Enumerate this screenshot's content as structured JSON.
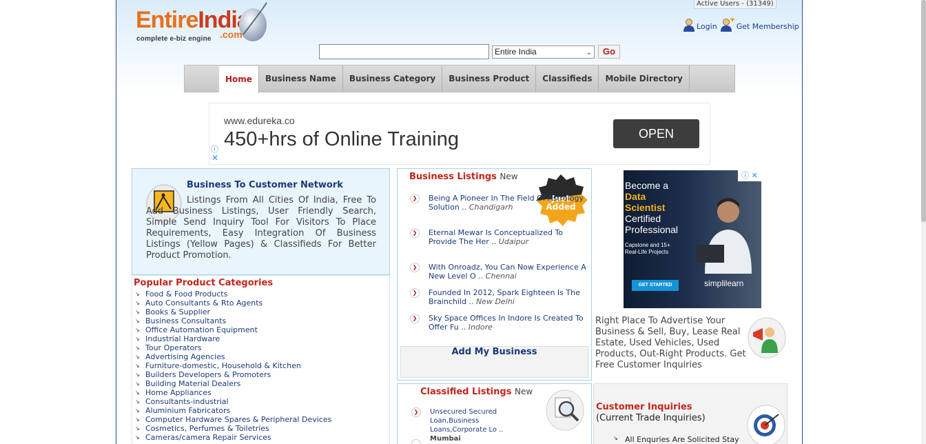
{
  "header": {
    "logo": {
      "part1": "Entire",
      "part2": "India",
      "com": ".com",
      "tagline": "complete e-biz engine"
    },
    "active_users": "Active Users - (31349)",
    "login_label": "Login",
    "membership_label": "Get Membership"
  },
  "search": {
    "value": "",
    "city_selected": "Entire India",
    "go_label": "Go"
  },
  "nav": {
    "tabs": [
      {
        "label": "Home",
        "active": true
      },
      {
        "label": "Business Name"
      },
      {
        "label": "Business Category"
      },
      {
        "label": "Business Product"
      },
      {
        "label": "Classifieds"
      },
      {
        "label": "Mobile Directory"
      }
    ]
  },
  "ad_top": {
    "url": "www.edureka.co",
    "headline": "450+hrs of Online Training",
    "button": "OPEN",
    "info_glyph": "ⓘ",
    "close_glyph": "✕"
  },
  "b2c": {
    "title": "Business To Customer Network",
    "description": "Listings From All Cities Of India, Free To Add Business Listings, User Friendly Search, Simple Send Inquiry Tool For Visitors To Place Requirements, Easy Integration Of Business Listings (Yellow Pages) & Classifieds For Better Product Promotion."
  },
  "popular": {
    "title": "Popular Product Categories",
    "items": [
      "Food & Food Products",
      "Auto Consultants & Rto Agents",
      "Books & Supplier",
      "Business Consultants",
      "Office Automation Equipment",
      "Industrial Hardware",
      "Tour Operators",
      "Advertising Agencies",
      "Furniture-domestic, Household & Kitchen",
      "Builders Developers & Promoters",
      "Building Material Dealers",
      "Home Appliances",
      "Consultants-industrial",
      "Aluminium Fabricators",
      "Computer Hardware Spares & Peripheral Devices",
      "Cosmetics, Perfumes & Toiletries",
      "Cameras/camera Repair Services"
    ]
  },
  "business_listings": {
    "title": "Business Listings",
    "new_label": "New",
    "badge_line1": "Just",
    "badge_line2": "Added",
    "items": [
      {
        "text": "Being A Pioneer In The Field Of Astrology Solution ..",
        "city": "Chandigarh"
      },
      {
        "text": "Eternal Mewar Is Conceptualized To Provide The Her ..",
        "city": "Udaipur"
      },
      {
        "text": "With Onroadz, You Can Now Experience A New Level O ..",
        "city": "Chennai"
      },
      {
        "text": "Founded In 2012, Spark Eighteen Is The Brainchild ..",
        "city": "New Delhi"
      },
      {
        "text": "Sky Space Offices In Indore Is Created To Offer Fu ..",
        "city": "Indore"
      }
    ],
    "add_label": "Add My Business"
  },
  "classified_listings": {
    "title": "Classified Listings",
    "new_label": "New",
    "items": [
      {
        "text": "Unsecured Secured Loan,Business Loans,Corporate Lo ..",
        "city": "Mumbai"
      }
    ]
  },
  "ad_side": {
    "line1": "Become a",
    "line2": "Data",
    "line3": "Scientist",
    "line4": "Certified",
    "line5": "Professional",
    "small1": "Capstone and 15+",
    "small2": "Real-Life Projects",
    "button": "GET STARTED",
    "brand": "simplilearn",
    "info_glyphs": "ⓘ ✕"
  },
  "advertise": {
    "text": "Right Place To Advertise Your Business & Sell, Buy, Lease Real Estate, Used Vehicles, Used Products, Out-Right Products. Get Free Customer Inquiries"
  },
  "inquiries": {
    "title": "Customer Inquiries",
    "subtitle": "(Current Trade Inquiries)",
    "items": [
      "All Enquries Are Solicited Stay"
    ]
  },
  "glyphs": {
    "bullet": "↘",
    "arrow": "❯",
    "select_arrow": "⌄"
  },
  "colors": {
    "accent_red": "#c2261c",
    "link_blue": "#1b3a7a",
    "logo_orange": "#e8701b"
  }
}
